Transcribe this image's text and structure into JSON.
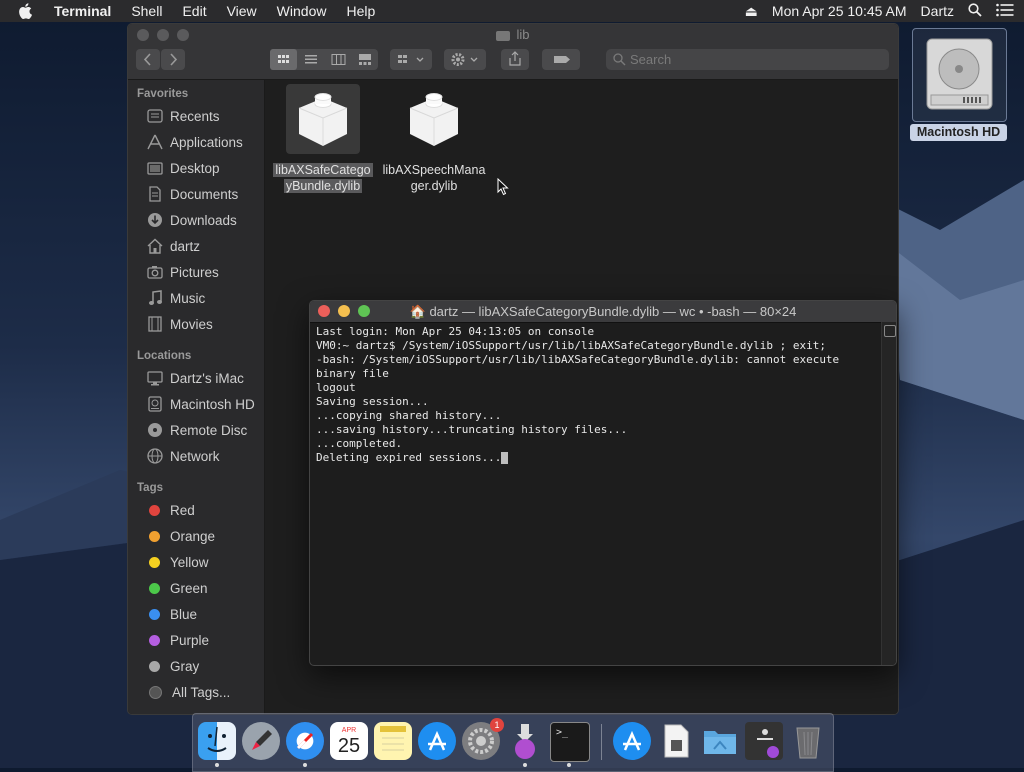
{
  "menubar": {
    "app_name": "Terminal",
    "menus": [
      "Shell",
      "Edit",
      "View",
      "Window",
      "Help"
    ],
    "datetime": "Mon Apr 25  10:45 AM",
    "user": "Dartz"
  },
  "desktop": {
    "hd_label": "Macintosh HD"
  },
  "finder": {
    "title": "lib",
    "search_placeholder": "Search",
    "sidebar": {
      "favorites_header": "Favorites",
      "favorites": [
        "Recents",
        "Applications",
        "Desktop",
        "Documents",
        "Downloads",
        "dartz",
        "Pictures",
        "Music",
        "Movies"
      ],
      "locations_header": "Locations",
      "locations": [
        "Dartz's iMac",
        "Macintosh HD",
        "Remote Disc",
        "Network"
      ],
      "tags_header": "Tags",
      "tags": [
        {
          "label": "Red",
          "color": "#e0443e"
        },
        {
          "label": "Orange",
          "color": "#f0a030"
        },
        {
          "label": "Yellow",
          "color": "#f5d020"
        },
        {
          "label": "Green",
          "color": "#4cc84a"
        },
        {
          "label": "Blue",
          "color": "#3a8ff0"
        },
        {
          "label": "Purple",
          "color": "#b45ee0"
        },
        {
          "label": "Gray",
          "color": "#a8a8a8"
        }
      ],
      "all_tags": "All Tags..."
    },
    "files": [
      {
        "line1": "libAXSafeCatego",
        "line2": "yBundle.dylib",
        "selected": true
      },
      {
        "line1": "libAXSpeechMana",
        "line2": "ger.dylib",
        "selected": false
      }
    ]
  },
  "terminal": {
    "title": "dartz — libAXSafeCategoryBundle.dylib — wc • -bash — 80×24",
    "lines": [
      "Last login: Mon Apr 25 04:13:05 on console",
      "VM0:~ dartz$ /System/iOSSupport/usr/lib/libAXSafeCategoryBundle.dylib ; exit;",
      "-bash: /System/iOSSupport/usr/lib/libAXSafeCategoryBundle.dylib: cannot execute",
      "binary file",
      "logout",
      "Saving session...",
      "...copying shared history...",
      "...saving history...truncating history files...",
      "...completed.",
      "Deleting expired sessions..."
    ]
  },
  "dock": {
    "items": [
      "finder-icon",
      "launchpad-icon",
      "safari-icon",
      "calendar-icon",
      "notes-icon",
      "app-store-icon",
      "system-preferences-icon",
      "installer-icon",
      "terminal-icon",
      "app-store-download-icon",
      "document-icon",
      "folder-icon",
      "utility-icon",
      "trash-icon"
    ],
    "calendar_month": "APR",
    "calendar_day": "25",
    "system_prefs_badge": "1"
  }
}
